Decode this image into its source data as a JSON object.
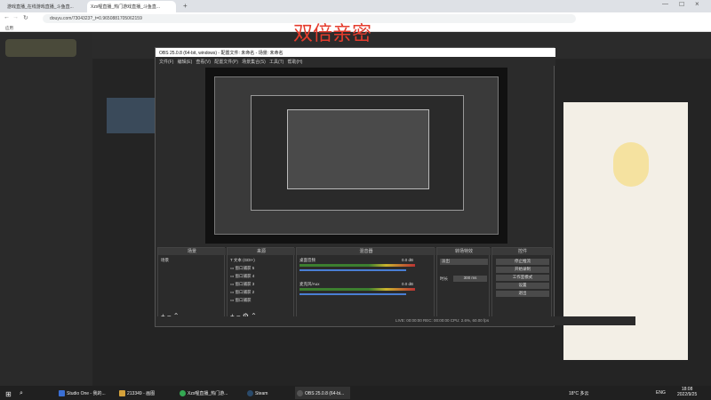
{
  "browser": {
    "tabs": [
      "游戏直播_在线游戏直播_斗鱼直...",
      "Xzx喔直播_热门游戏直播_斗鱼直..."
    ],
    "url": "douyu.com/7304323?_t=0.9650881705062159",
    "bookmark": "应用"
  },
  "overlay_title": "双倍亲密",
  "obs": {
    "title": "OBS 25.0.8 (64-bit, windows) - 配置文件: 未命名 - 场景: 未命名",
    "menu": [
      "文件(F)",
      "编辑(E)",
      "查看(V)",
      "配置文件(P)",
      "场景集合(S)",
      "工具(T)",
      "帮助(H)"
    ],
    "docks": {
      "scenes": {
        "title": "场景",
        "items": [
          "场景"
        ]
      },
      "sources": {
        "title": "来源",
        "items": [
          "文本 (GDI+)",
          "窗口捕获 5",
          "窗口捕获 4",
          "窗口捕获 3",
          "窗口捕获 2",
          "窗口捕获"
        ]
      },
      "mixer": {
        "title": "混音器",
        "tracks": [
          "桌面音频",
          "麦克风/Aux"
        ],
        "level": "0.0 dB"
      },
      "transitions": {
        "title": "转场特效",
        "type": "淡出",
        "duration_label": "时长",
        "duration": "300 ms"
      },
      "controls": {
        "title": "控件",
        "buttons": [
          "停止推流",
          "开始录制",
          "工作室模式",
          "设置",
          "退出"
        ]
      }
    },
    "status": "LIVE: 00:00:00   REC: 00:00:00   CPU: 2.6%, 60.00 fps"
  },
  "taskbar": {
    "items": [
      "Studio One - 我的...",
      "213349 - 画图",
      "Xzx喔直播_热门游...",
      "Steam",
      "OBS 25.0.8 (64-bi..."
    ],
    "weather": "18°C 多云",
    "lang": "ENG",
    "time": "18:08",
    "date": "2022/9/25"
  }
}
